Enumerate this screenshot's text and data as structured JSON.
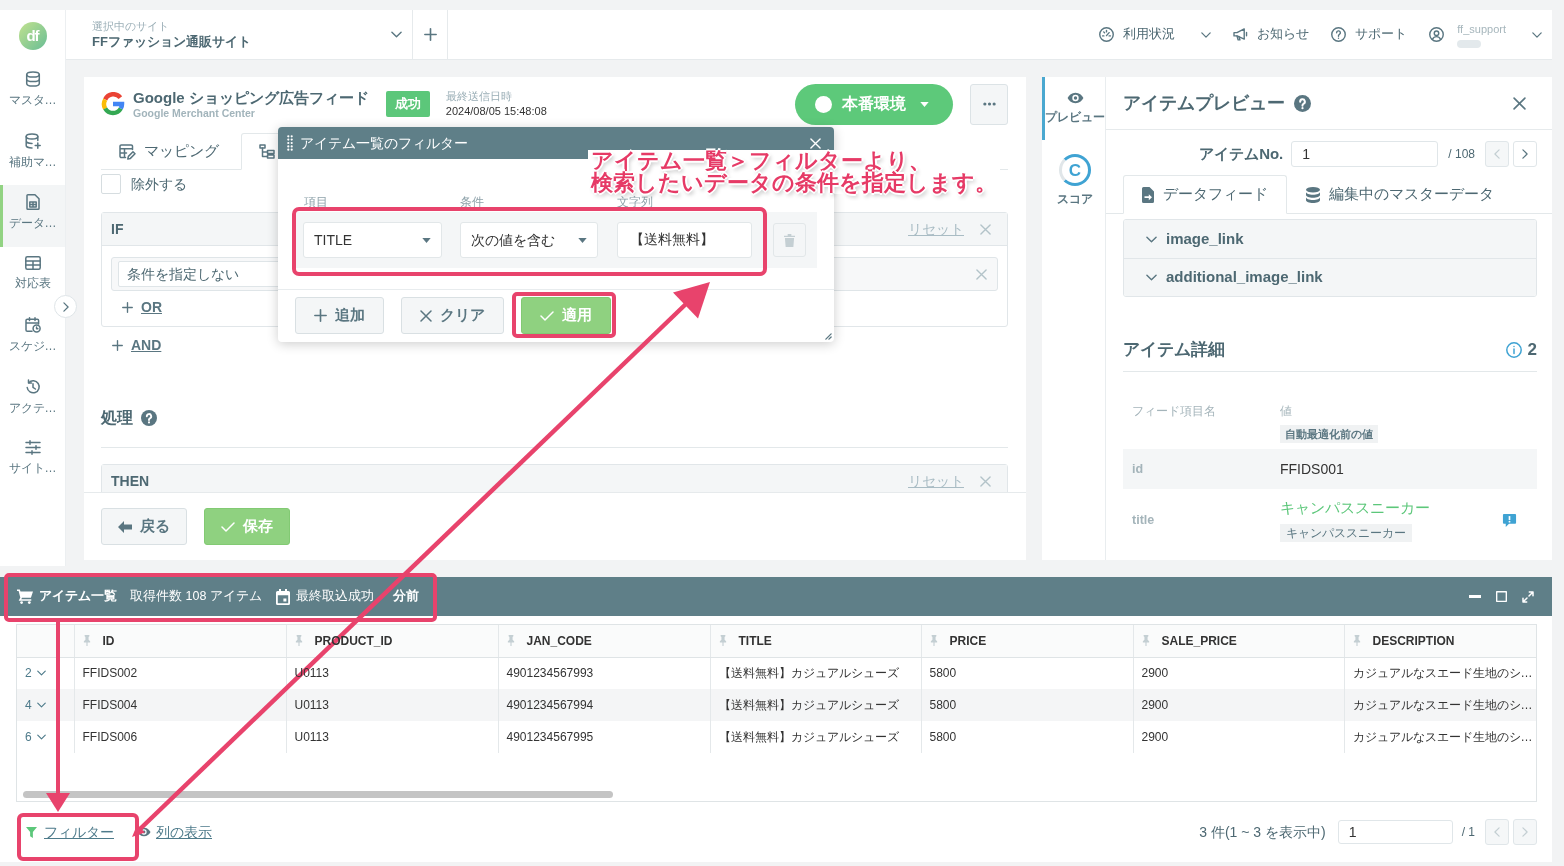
{
  "header": {
    "logo_text": "df",
    "site_label": "選択中のサイト",
    "site_name": "FFファッション通販サイト",
    "menu": [
      {
        "kind": "usage",
        "label": "利用状況",
        "dropdown": true
      },
      {
        "kind": "news",
        "label": "お知らせ",
        "dropdown": false
      },
      {
        "kind": "support",
        "label": "サポート",
        "dropdown": false
      }
    ],
    "user": {
      "name": "ff_support",
      "dropdown": true
    }
  },
  "sidebar": {
    "items": [
      {
        "kind": "master",
        "label": "マスタ…",
        "selected": false
      },
      {
        "kind": "auxiliary",
        "label": "補助マ…",
        "selected": false
      },
      {
        "kind": "feed",
        "label": "データ…",
        "selected": true
      },
      {
        "kind": "mapping",
        "label": "対応表",
        "selected": false
      },
      {
        "kind": "schedule",
        "label": "スケジ…",
        "selected": false
      },
      {
        "kind": "activity",
        "label": "アクテ…",
        "selected": false
      },
      {
        "kind": "settings",
        "label": "サイト…",
        "selected": false
      }
    ]
  },
  "feed": {
    "title": "Google ショッピング広告フィード",
    "subtitle": "Google Merchant Center",
    "status": "成功",
    "last_sent_label": "最終送信日時",
    "last_sent": "2024/08/05 15:48:08",
    "environment": "本番環境"
  },
  "tabs": [
    {
      "kind": "mapping",
      "label": "マッピング",
      "selected": false
    },
    {
      "kind": "rules",
      "selected": true
    }
  ],
  "editor": {
    "exclude": {
      "label": "除外する",
      "checked": false
    },
    "condition_block": {
      "title": "IF",
      "reset": "リセット",
      "condition": "条件を指定しない",
      "add_or": "OR"
    },
    "add_and": "AND",
    "process_title": "処理",
    "action_block": {
      "title": "THEN",
      "reset": "リセット"
    },
    "buttons": [
      {
        "kind": "back",
        "label": "戻る"
      },
      {
        "kind": "save",
        "label": "保存"
      }
    ]
  },
  "filter_dialog": {
    "title": "アイテム一覧のフィルター",
    "columns": [
      "項目",
      "条件",
      "文字列"
    ],
    "rows": [
      {
        "field": "TITLE",
        "operator": "次の値を含む",
        "value": "【送料無料】"
      }
    ],
    "buttons": [
      {
        "kind": "add",
        "label": "追加"
      },
      {
        "kind": "clear",
        "label": "クリア"
      },
      {
        "kind": "apply",
        "label": "適用"
      }
    ]
  },
  "annotation": {
    "lines": [
      "アイテム一覧＞フィルターより、",
      "検索したいデータの条件を指定します。"
    ]
  },
  "side_tabs": [
    {
      "kind": "preview",
      "label": "プレビュー",
      "selected": true
    },
    {
      "kind": "score",
      "label": "スコア",
      "grade": "C",
      "selected": false
    }
  ],
  "preview": {
    "title": "アイテムプレビュー",
    "item_no_label": "アイテムNo.",
    "item_no": "1",
    "item_total": "/ 108",
    "pager": [
      {
        "kind": "prev",
        "disabled": true
      },
      {
        "kind": "next",
        "disabled": false
      }
    ],
    "tabs": [
      {
        "kind": "feed",
        "label": "データフィード",
        "selected": true
      },
      {
        "kind": "master",
        "label": "編集中のマスターデータ",
        "selected": false
      }
    ],
    "sections": [
      {
        "label": "image_link",
        "expanded": false
      },
      {
        "label": "additional_image_link",
        "expanded": false
      }
    ],
    "detail_title": "アイテム詳細",
    "detail_count": "2",
    "detail_columns": [
      "フィード項目名",
      "値"
    ],
    "value_note": "自動最適化前の値",
    "fields": [
      {
        "name": "id",
        "value": "FFIDS001",
        "optimized": false
      },
      {
        "name": "title",
        "value": "キャンパススニーカー",
        "original": "キャンパススニーカー",
        "optimized": true
      }
    ]
  },
  "items_panel": {
    "title": "アイテム一覧",
    "count": "取得件数 108 アイテム",
    "last_import": "最終取込成功",
    "last_import_suffix": "分前",
    "columns": [
      "ID",
      "PRODUCT_ID",
      "JAN_CODE",
      "TITLE",
      "PRICE",
      "SALE_PRICE",
      "DESCRIPTION"
    ],
    "rows": [
      {
        "no": "2",
        "expanded": false,
        "cells": [
          "FFIDS002",
          "U0113",
          "4901234567993",
          "【送料無料】カジュアルシューズ",
          "5800",
          "2900",
          "カジュアルなスエード生地のシ…"
        ]
      },
      {
        "no": "4",
        "expanded": false,
        "cells": [
          "FFIDS004",
          "U0113",
          "4901234567994",
          "【送料無料】カジュアルシューズ",
          "5800",
          "2900",
          "カジュアルなスエード生地のシ…"
        ]
      },
      {
        "no": "6",
        "expanded": false,
        "cells": [
          "FFIDS006",
          "U0113",
          "4901234567995",
          "【送料無料】カジュアルシューズ",
          "5800",
          "2900",
          "カジュアルなスエード生地のシ…"
        ]
      }
    ],
    "filter_link": "フィルター",
    "columns_link": "列の表示",
    "summary": "3 件(1 ~ 3 を表示中)",
    "page": "1",
    "page_total": "/ 1",
    "pager": [
      {
        "kind": "prev",
        "disabled": true
      },
      {
        "kind": "next",
        "disabled": true
      }
    ]
  }
}
